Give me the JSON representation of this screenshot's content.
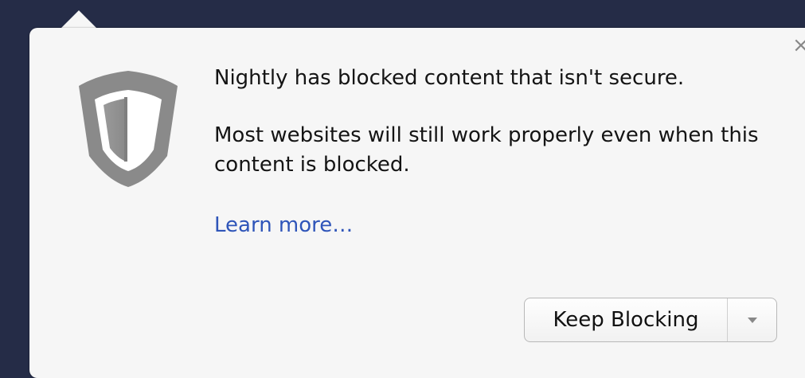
{
  "notification": {
    "headline": "Nightly has blocked content that isn't secure.",
    "body": "Most websites will still work properly even when this content is blocked.",
    "learn_more": "Learn more…",
    "close_glyph": "×"
  },
  "actions": {
    "primary_label": "Keep Blocking",
    "menu_icon": "chevron-down-icon"
  },
  "icons": {
    "shield": "shield-icon"
  },
  "colors": {
    "background": "#252c47",
    "panel": "#f6f6f6",
    "link": "#2f55b9",
    "shield_outer": "#8a8a8a"
  }
}
